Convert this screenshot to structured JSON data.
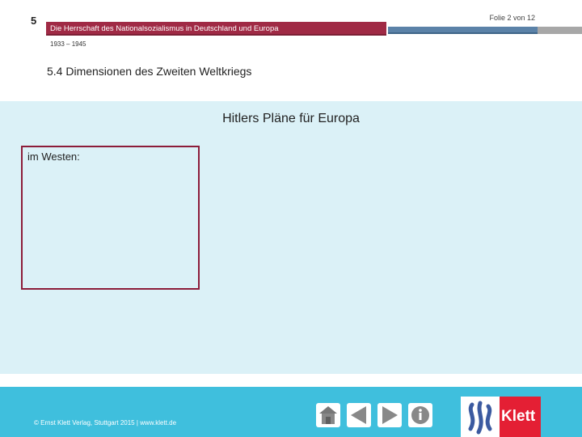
{
  "header": {
    "chapter_number": "5",
    "slide_counter": "Folie 2 von 12",
    "chapter_title": "Die Herrschaft des Nationalsozialismus in Deutschland und Europa",
    "period": "1933 – 1945",
    "section_heading": "5.4 Dimensionen des Zweiten Weltkriegs"
  },
  "main": {
    "heading": "Hitlers Pläne für Europa",
    "west_box_label": "im Westen:"
  },
  "footer": {
    "copyright": "© Ernst Klett Verlag, Stuttgart 2015 | www.klett.de",
    "logo_text": "Klett",
    "nav_icons": [
      "home-icon",
      "back-arrow-icon",
      "forward-arrow-icon",
      "info-icon"
    ]
  },
  "colors": {
    "title_bar": "#a02a45",
    "rule_blue": "#5b82a8",
    "content_bg": "#dbf1f7",
    "box_border": "#8c1d3a",
    "footer_bg": "#3fbfdd",
    "logo_red": "#e41f34"
  }
}
